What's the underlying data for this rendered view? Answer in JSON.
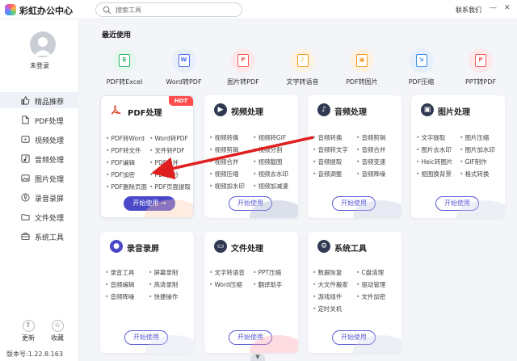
{
  "app": {
    "title": "彩虹办公中心",
    "contact": "联系我们"
  },
  "search": {
    "placeholder": "搜索工具"
  },
  "user": {
    "login": "未登录"
  },
  "nav": [
    {
      "label": "精品推荐",
      "icon": "thumbs-up-icon",
      "active": true
    },
    {
      "label": "PDF处理",
      "icon": "pdf-icon"
    },
    {
      "label": "视频处理",
      "icon": "video-icon"
    },
    {
      "label": "音频处理",
      "icon": "music-icon"
    },
    {
      "label": "图片处理",
      "icon": "image-icon"
    },
    {
      "label": "录音录屏",
      "icon": "microphone-icon"
    },
    {
      "label": "文件处理",
      "icon": "folder-icon"
    },
    {
      "label": "系统工具",
      "icon": "toolbox-icon"
    }
  ],
  "bottom": {
    "update": "更新",
    "favorite": "收藏",
    "version": "版本号:1.22.8.163"
  },
  "recent": {
    "title": "最近使用",
    "items": [
      {
        "label": "PDF转Excel",
        "glyph": "E",
        "color": "#2fb36b",
        "bg": "#e7f6ee"
      },
      {
        "label": "Word转PDF",
        "glyph": "W",
        "color": "#4a6cf0",
        "bg": "#e8eefc"
      },
      {
        "label": "图片转PDF",
        "glyph": "P",
        "color": "#ef5a5a",
        "bg": "#fde9e9"
      },
      {
        "label": "文字转语音",
        "glyph": "♪",
        "color": "#f0a020",
        "bg": "#fdf3e3"
      },
      {
        "label": "PDF转图片",
        "glyph": "▣",
        "color": "#f59a23",
        "bg": "#fdf1e2"
      },
      {
        "label": "PDF压缩",
        "glyph": "⇲",
        "color": "#3c8ee8",
        "bg": "#e5f0fc"
      },
      {
        "label": "PPT转PDF",
        "glyph": "P",
        "color": "#ef5a5a",
        "bg": "#fde9e9"
      }
    ]
  },
  "cards": [
    {
      "title": "PDF处理",
      "hot": "HOT",
      "button": "开始使用 →",
      "items": [
        "PDF转Word",
        "Word转PDF",
        "PDF转文件",
        "文件转PDF",
        "PDF编辑",
        "PDF合并",
        "PDF加密",
        "PDF拆分",
        "PDF删除页面",
        "PDF页面提取"
      ]
    },
    {
      "title": "视频处理",
      "button": "开始使用",
      "items": [
        "视频转换",
        "视频转GIF",
        "视频剪辑",
        "视频分割",
        "视频合并",
        "视频截图",
        "视频压缩",
        "视频去水印",
        "视频加水印",
        "视频加减速"
      ]
    },
    {
      "title": "音频处理",
      "button": "开始使用",
      "items": [
        "音频转换",
        "音频剪辑",
        "音频转文字",
        "音频合并",
        "音频提取",
        "音频变速",
        "音频调整",
        "音频降噪"
      ]
    },
    {
      "title": "图片处理",
      "button": "开始使用",
      "items": [
        "文字提取",
        "图片压缩",
        "图片去水印",
        "图片加水印",
        "Heic转图片",
        "GIF制作",
        "抠图换背景",
        "格式转换"
      ]
    },
    {
      "title": "录音录屏",
      "button": "开始使用",
      "items": [
        "录音工具",
        "屏幕录制",
        "音频编辑",
        "高清录制",
        "音频降噪",
        "快捷操作"
      ]
    },
    {
      "title": "文件处理",
      "button": "开始使用",
      "items": [
        "文字转语音",
        "PPT压缩",
        "Word压缩",
        "翻译助手"
      ]
    },
    {
      "title": "系统工具",
      "button": "开始使用",
      "items": [
        "数据恢复",
        "C盘清理",
        "大文件搬家",
        "驱动管理",
        "游戏组件",
        "文件加密",
        "定时关机"
      ]
    }
  ],
  "colors": {
    "accent": "#4a48c8",
    "hot": "#ff4d4f",
    "arrow": "#e02020"
  }
}
